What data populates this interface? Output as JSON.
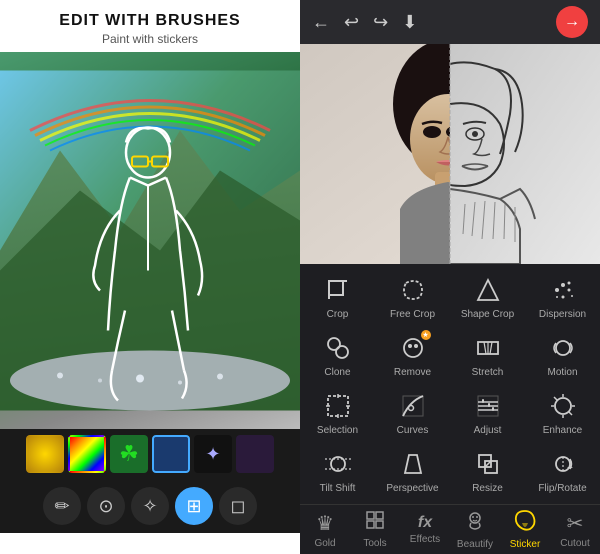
{
  "left": {
    "title": "EDIT WITH BRUSHES",
    "subtitle": "Paint with stickers",
    "stickers": [
      {
        "id": "gold",
        "label": "gold",
        "type": "gold"
      },
      {
        "id": "rainbow",
        "label": "rainbow",
        "type": "rainbow"
      },
      {
        "id": "clover",
        "label": "clover",
        "type": "clover",
        "symbol": "☘"
      },
      {
        "id": "blue-selected",
        "label": "blue",
        "type": "blue",
        "selected": true
      },
      {
        "id": "sparkle",
        "label": "sparkle",
        "type": "sparkle",
        "symbol": "✦"
      },
      {
        "id": "dark",
        "label": "dark",
        "type": "dark"
      }
    ],
    "brushTools": [
      {
        "id": "brush1",
        "symbol": "✏",
        "active": false
      },
      {
        "id": "brush2",
        "symbol": "⊙",
        "active": false
      },
      {
        "id": "brush3",
        "symbol": "✧",
        "active": false
      },
      {
        "id": "brush4",
        "symbol": "⊞",
        "active": true,
        "highlight": true
      },
      {
        "id": "eraser",
        "symbol": "◻",
        "active": false
      }
    ]
  },
  "right": {
    "topbar": {
      "backLabel": "←",
      "undoLabel": "↩",
      "redoLabel": "↪",
      "downloadLabel": "⬇",
      "nextLabel": "→"
    },
    "tools": [
      {
        "id": "crop",
        "label": "Crop",
        "icon": "crop"
      },
      {
        "id": "free-crop",
        "label": "Free Crop",
        "icon": "freecrop"
      },
      {
        "id": "shape-crop",
        "label": "Shape Crop",
        "icon": "shapecrop"
      },
      {
        "id": "dispersion",
        "label": "Dispersion",
        "icon": "dispersion"
      },
      {
        "id": "clone",
        "label": "Clone",
        "icon": "clone"
      },
      {
        "id": "remove",
        "label": "Remove",
        "icon": "remove"
      },
      {
        "id": "stretch",
        "label": "Stretch",
        "icon": "stretch"
      },
      {
        "id": "motion",
        "label": "Motion",
        "icon": "motion"
      },
      {
        "id": "selection",
        "label": "Selection",
        "icon": "selection"
      },
      {
        "id": "curves",
        "label": "Curves",
        "icon": "curves"
      },
      {
        "id": "adjust",
        "label": "Adjust",
        "icon": "adjust"
      },
      {
        "id": "enhance",
        "label": "Enhance",
        "icon": "enhance"
      },
      {
        "id": "tilt-shift",
        "label": "Tilt Shift",
        "icon": "tiltshift"
      },
      {
        "id": "perspective",
        "label": "Perspective",
        "icon": "perspective"
      },
      {
        "id": "resize",
        "label": "Resize",
        "icon": "resize"
      },
      {
        "id": "flip-rotate",
        "label": "Flip/Rotate",
        "icon": "fliprotate"
      }
    ],
    "bottomNav": [
      {
        "id": "gold",
        "label": "Gold",
        "icon": "♛",
        "active": false
      },
      {
        "id": "tools",
        "label": "Tools",
        "icon": "▣",
        "active": false
      },
      {
        "id": "effects",
        "label": "Effects",
        "icon": "ƒx",
        "active": false
      },
      {
        "id": "beautify",
        "label": "Beautify",
        "icon": "☺",
        "active": false
      },
      {
        "id": "sticker",
        "label": "Sticker",
        "icon": "★",
        "active": true
      },
      {
        "id": "cutout",
        "label": "Cutout",
        "icon": "✂",
        "active": false
      }
    ]
  }
}
